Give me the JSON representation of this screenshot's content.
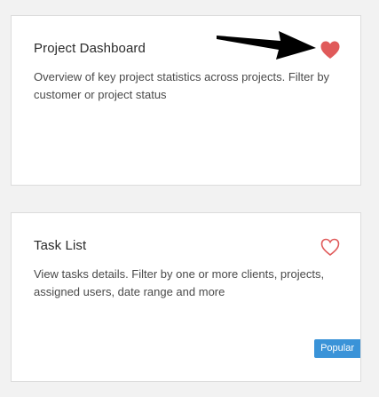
{
  "cards": [
    {
      "title": "Project Dashboard",
      "description": "Overview of key project statistics across projects. Filter by customer or project status",
      "favorite": true,
      "favorite_icon": "heart-filled-icon",
      "favorite_color": "#e05a5a"
    },
    {
      "title": "Task List",
      "description": "View tasks details. Filter by one or more clients, projects, assigned users, date range and more",
      "favorite": false,
      "favorite_icon": "heart-outline-icon",
      "favorite_color": "#e05a5a",
      "badge": "Popular",
      "badge_color": "#3a93d8"
    }
  ],
  "annotation": {
    "icon": "arrow-icon",
    "color": "#000000"
  }
}
